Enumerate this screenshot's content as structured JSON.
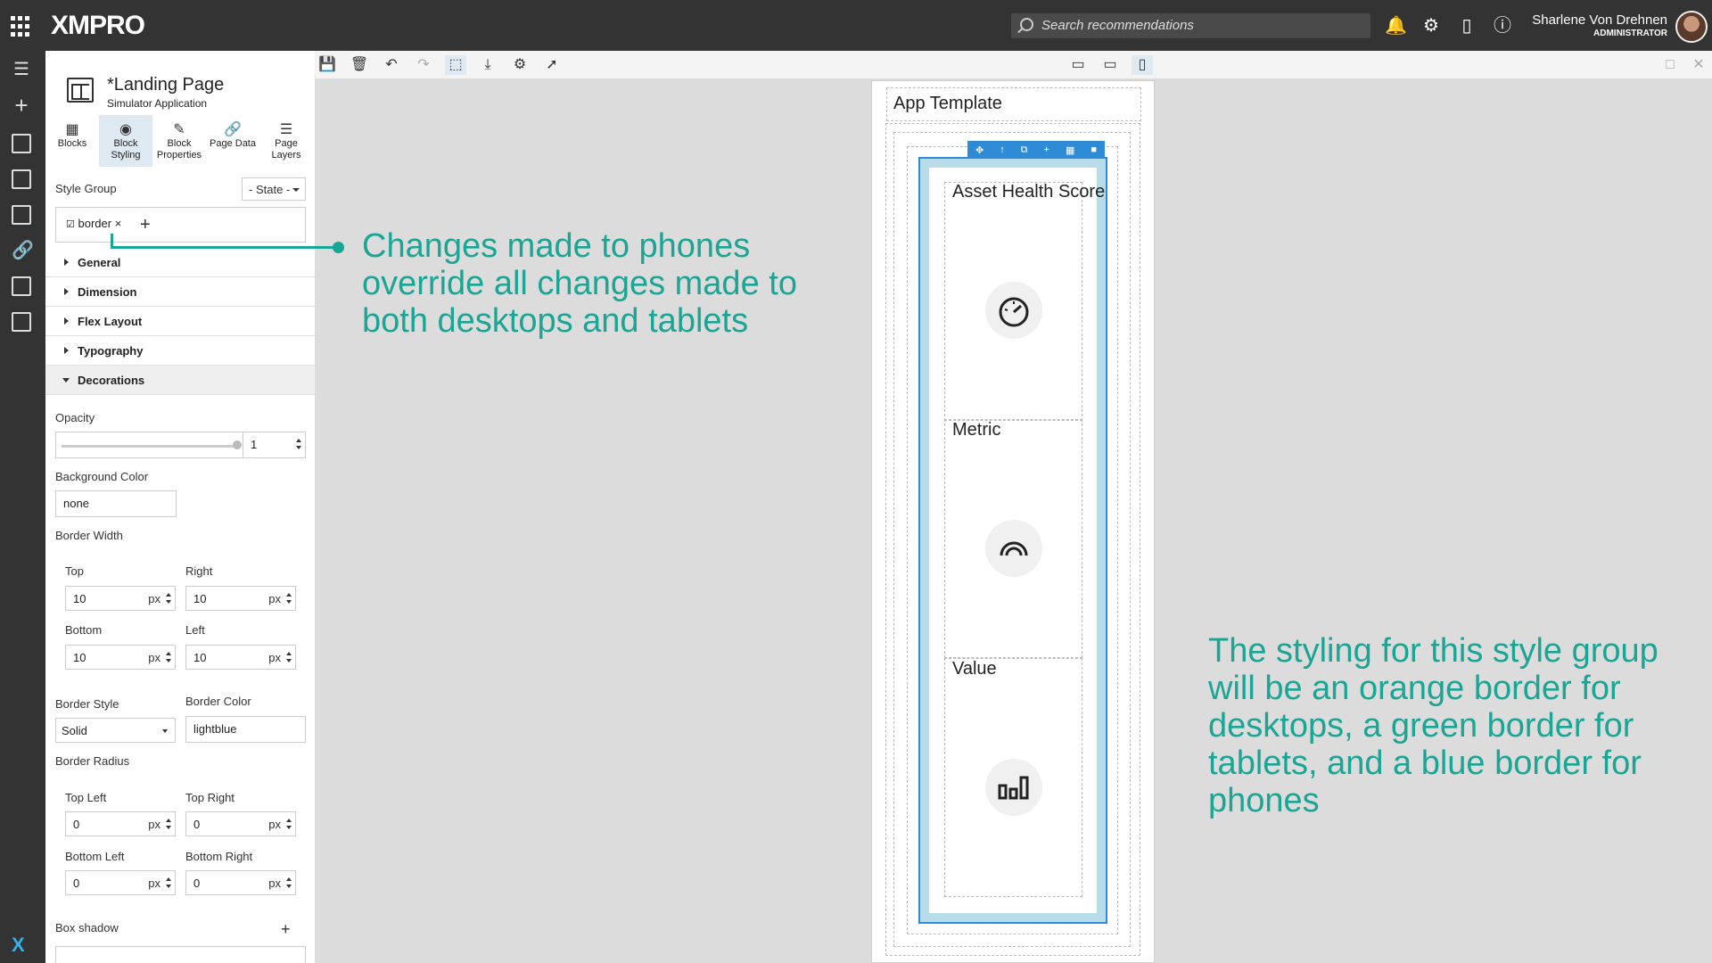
{
  "app": {
    "logo": "XMPRO",
    "search_placeholder": "Search recommendations",
    "user_name": "Sharlene Von Drehnen",
    "user_role": "ADMINISTRATOR"
  },
  "page": {
    "title": "*Landing Page",
    "subtitle": "Simulator Application"
  },
  "tabs": [
    {
      "label": "Blocks",
      "icon": "blocks-icon"
    },
    {
      "label": "Block Styling",
      "icon": "palette-icon"
    },
    {
      "label": "Block Properties",
      "icon": "pencil-icon"
    },
    {
      "label": "Page Data",
      "icon": "link-icon"
    },
    {
      "label": "Page Layers",
      "icon": "layers-icon"
    }
  ],
  "style_group": {
    "label": "Style Group",
    "state_button": "- State -",
    "chip": "border",
    "chip_close": "×"
  },
  "sections": [
    "General",
    "Dimension",
    "Flex Layout",
    "Typography",
    "Decorations"
  ],
  "decorations": {
    "opacity_label": "Opacity",
    "opacity_value": "1",
    "opacity_level": 1,
    "bg_color_label": "Background Color",
    "bg_color_value": "none",
    "border_width_label": "Border Width",
    "top_label": "Top",
    "top_value": "10",
    "right_label": "Right",
    "right_value": "10",
    "bottom_label": "Bottom",
    "bottom_value": "10",
    "left_label": "Left",
    "left_value": "10",
    "unit": "px",
    "border_style_label": "Border Style",
    "border_style_value": "Solid",
    "border_color_label": "Border Color",
    "border_color_value": "lightblue",
    "border_radius_label": "Border Radius",
    "top_left_label": "Top Left",
    "top_left_value": "0",
    "top_right_label": "Top Right",
    "top_right_value": "0",
    "bottom_left_label": "Bottom Left",
    "bottom_left_value": "0",
    "bottom_right_label": "Bottom Right",
    "bottom_right_value": "0",
    "box_shadow_label": "Box shadow"
  },
  "canvas": {
    "app_template": "App Template",
    "cards": [
      "Asset Health Score",
      "Metric",
      "Value"
    ]
  },
  "annotations": {
    "note1": "Changes made to phones override all changes made to both desktops and tablets",
    "note2": "The styling for this style group will be an orange border for desktops, a green border for tablets, and a blue border for phones"
  },
  "colors": {
    "annotation": "#1aa594",
    "selection": "#2e8bd6",
    "border_lightblue": "#b9dcea",
    "topbar": "#333333"
  }
}
